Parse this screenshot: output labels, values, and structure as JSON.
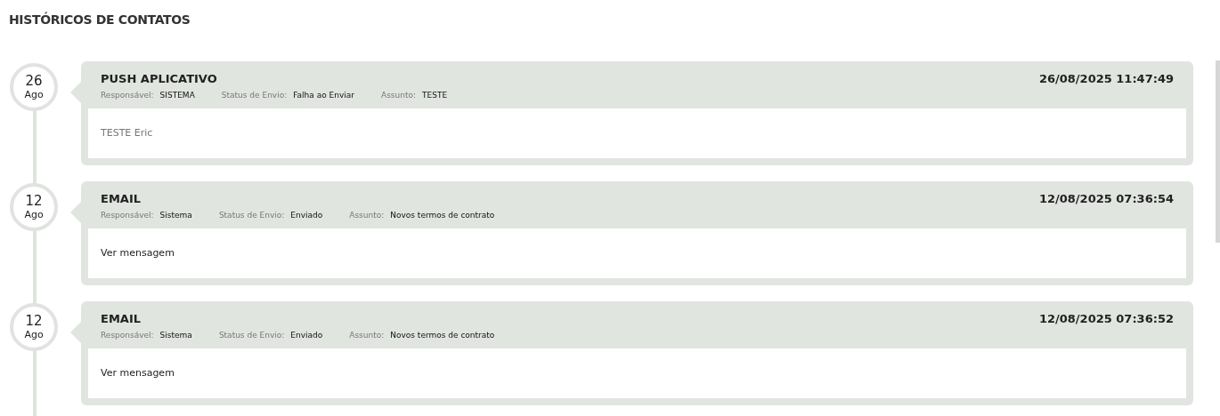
{
  "title": "HISTÓRICOS DE CONTATOS",
  "entries": [
    {
      "day": "26",
      "month": "Ago",
      "channel": "PUSH APLICATIVO",
      "datetime": "26/08/2025 11:47:49",
      "fields": [
        {
          "label": "Responsável:",
          "value": "SISTEMA"
        },
        {
          "label": "Status de Envio:",
          "value": "Falha ao Enviar"
        },
        {
          "label": "Assunto:",
          "value": "TESTE"
        }
      ],
      "body": {
        "kind": "text",
        "text": "TESTE Eric"
      }
    },
    {
      "day": "12",
      "month": "Ago",
      "channel": "EMAIL",
      "datetime": "12/08/2025 07:36:54",
      "fields": [
        {
          "label": "Responsável:",
          "value": "Sistema"
        },
        {
          "label": "Status de Envio:",
          "value": "Enviado"
        },
        {
          "label": "Assunto:",
          "value": "Novos termos de contrato"
        }
      ],
      "body": {
        "kind": "link",
        "text": "Ver mensagem"
      }
    },
    {
      "day": "12",
      "month": "Ago",
      "channel": "EMAIL",
      "datetime": "12/08/2025 07:36:52",
      "fields": [
        {
          "label": "Responsável:",
          "value": "Sistema"
        },
        {
          "label": "Status de Envio:",
          "value": "Enviado"
        },
        {
          "label": "Assunto:",
          "value": "Novos termos de contrato"
        }
      ],
      "body": {
        "kind": "link",
        "text": "Ver mensagem"
      }
    }
  ]
}
